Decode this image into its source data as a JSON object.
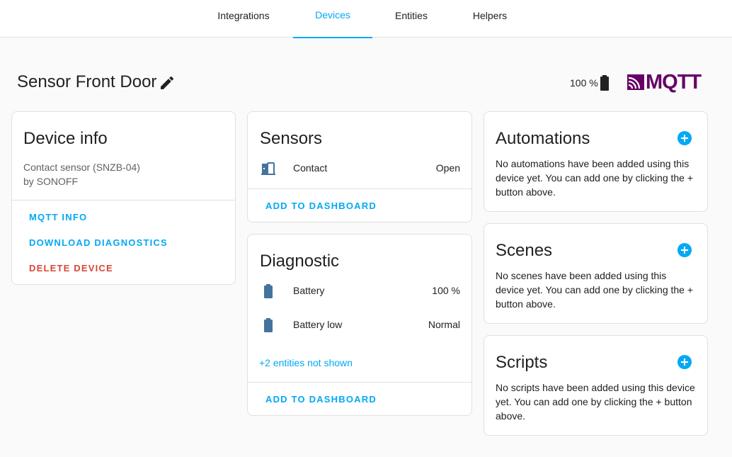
{
  "tabs": [
    {
      "label": "Integrations"
    },
    {
      "label": "Devices"
    },
    {
      "label": "Entities"
    },
    {
      "label": "Helpers"
    }
  ],
  "header": {
    "title": "Sensor Front Door",
    "battery": "100 %"
  },
  "brand": {
    "logo_text": "MQTT",
    "color": "#660066"
  },
  "device_info": {
    "title": "Device info",
    "model": "Contact sensor (SNZB-04)",
    "manufacturer": "by SONOFF",
    "actions": [
      "MQTT INFO",
      "DOWNLOAD DIAGNOSTICS",
      "DELETE DEVICE"
    ]
  },
  "sensors": {
    "title": "Sensors",
    "entities": [
      {
        "icon": "door-open-icon",
        "name": "Contact",
        "state": "Open"
      }
    ],
    "action": "ADD TO DASHBOARD"
  },
  "diagnostic": {
    "title": "Diagnostic",
    "entities": [
      {
        "icon": "battery-icon",
        "name": "Battery",
        "state": "100 %"
      },
      {
        "icon": "battery-icon",
        "name": "Battery low",
        "state": "Normal"
      }
    ],
    "more": "+2 entities not shown",
    "action": "ADD TO DASHBOARD"
  },
  "automations": {
    "title": "Automations",
    "text": "No automations have been added using this device yet. You can add one by clicking the + button above."
  },
  "scenes": {
    "title": "Scenes",
    "text": "No scenes have been added using this device yet. You can add one by clicking the + button above."
  },
  "scripts": {
    "title": "Scripts",
    "text": "No scripts have been added using this device yet. You can add one by clicking the + button above."
  },
  "colors": {
    "accent": "#03a9f4",
    "danger": "#db4437",
    "icon": "#44739e"
  }
}
